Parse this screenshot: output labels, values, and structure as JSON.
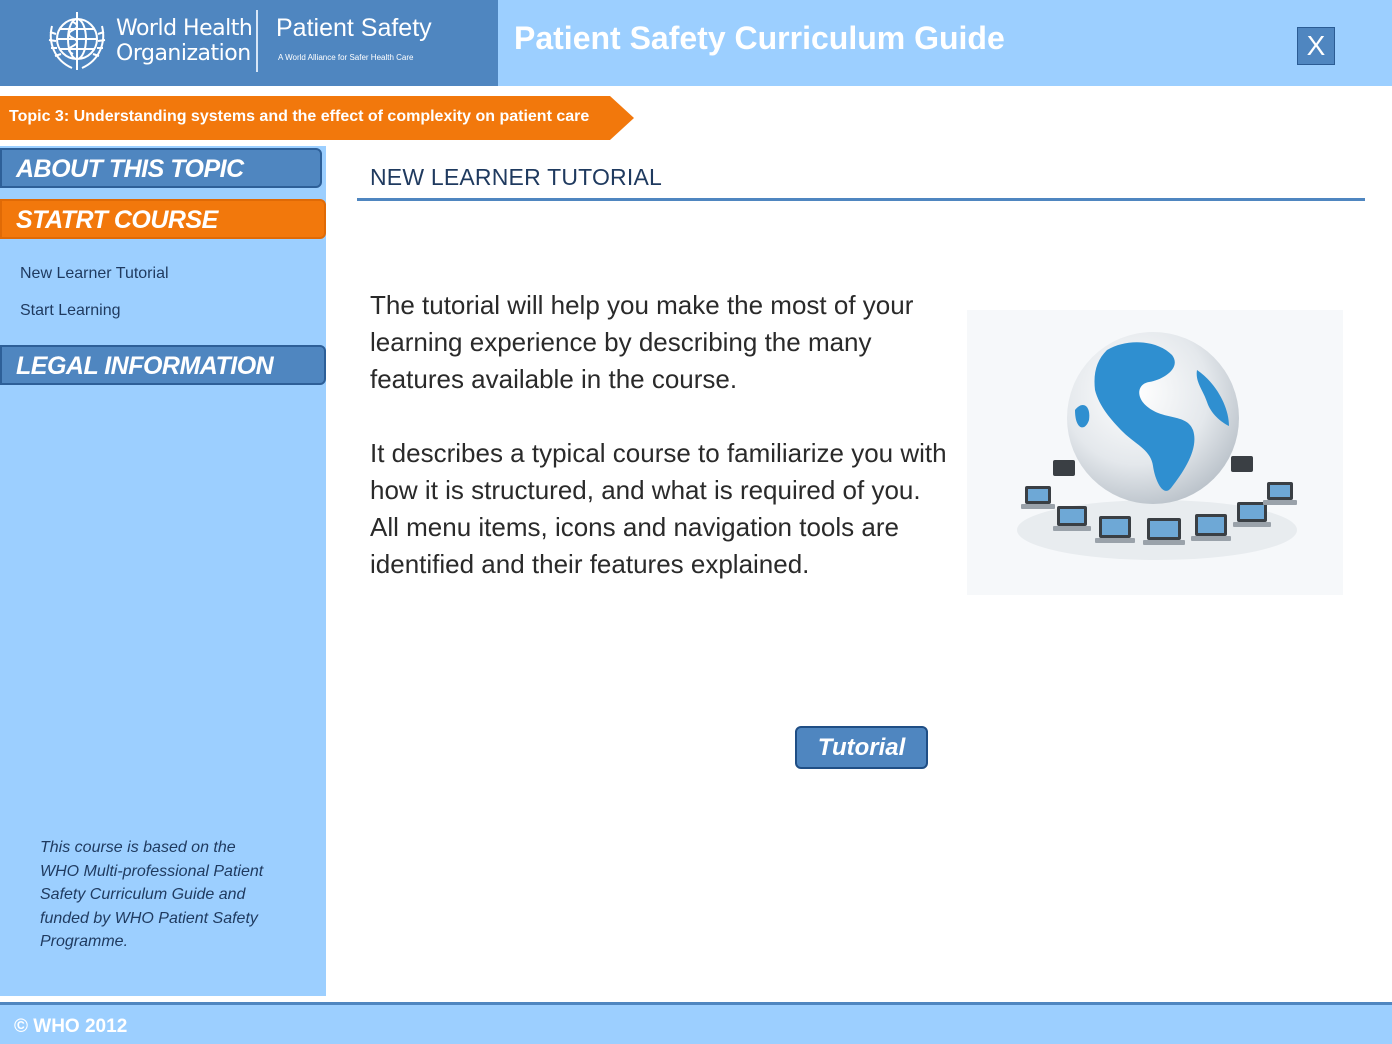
{
  "header": {
    "org_line1": "World Health",
    "org_line2": "Organization",
    "program_title": "Patient Safety",
    "program_subtitle": "A World Alliance for Safer Health Care",
    "app_title": "Patient Safety Curriculum Guide",
    "close_label": "X"
  },
  "topic": {
    "label": "Topic 3: Understanding systems and the effect of complexity on patient care"
  },
  "sidebar": {
    "about_label": "ABOUT THIS TOPIC",
    "start_label": "STATRT COURSE",
    "links": [
      "New Learner Tutorial",
      "Start Learning"
    ],
    "legal_label": "LEGAL INFORMATION",
    "note": "This course is based on the WHO Multi-professional Patient Safety Curriculum Guide and funded by WHO Patient Safety Programme."
  },
  "main": {
    "heading": "NEW LEARNER TUTORIAL",
    "paragraph1": "The tutorial will help you make the most of your learning experience by describing the many features available in the course.",
    "paragraph2": "It describes a typical course to familiarize you with how it is structured, and what is required of you. All menu items, icons and navigation tools are identified and their features explained.",
    "tutorial_button": "Tutorial"
  },
  "footer": {
    "copyright": "© WHO 2012"
  },
  "colors": {
    "header_bg": "#9ccfff",
    "logo_bg": "#4f86c0",
    "accent_orange": "#f2780c",
    "sidebar_bg": "#9ccfff",
    "text_dark": "#1f3a5f"
  },
  "icons": [
    "who-emblem-icon",
    "globe-network-icon",
    "close-icon"
  ]
}
